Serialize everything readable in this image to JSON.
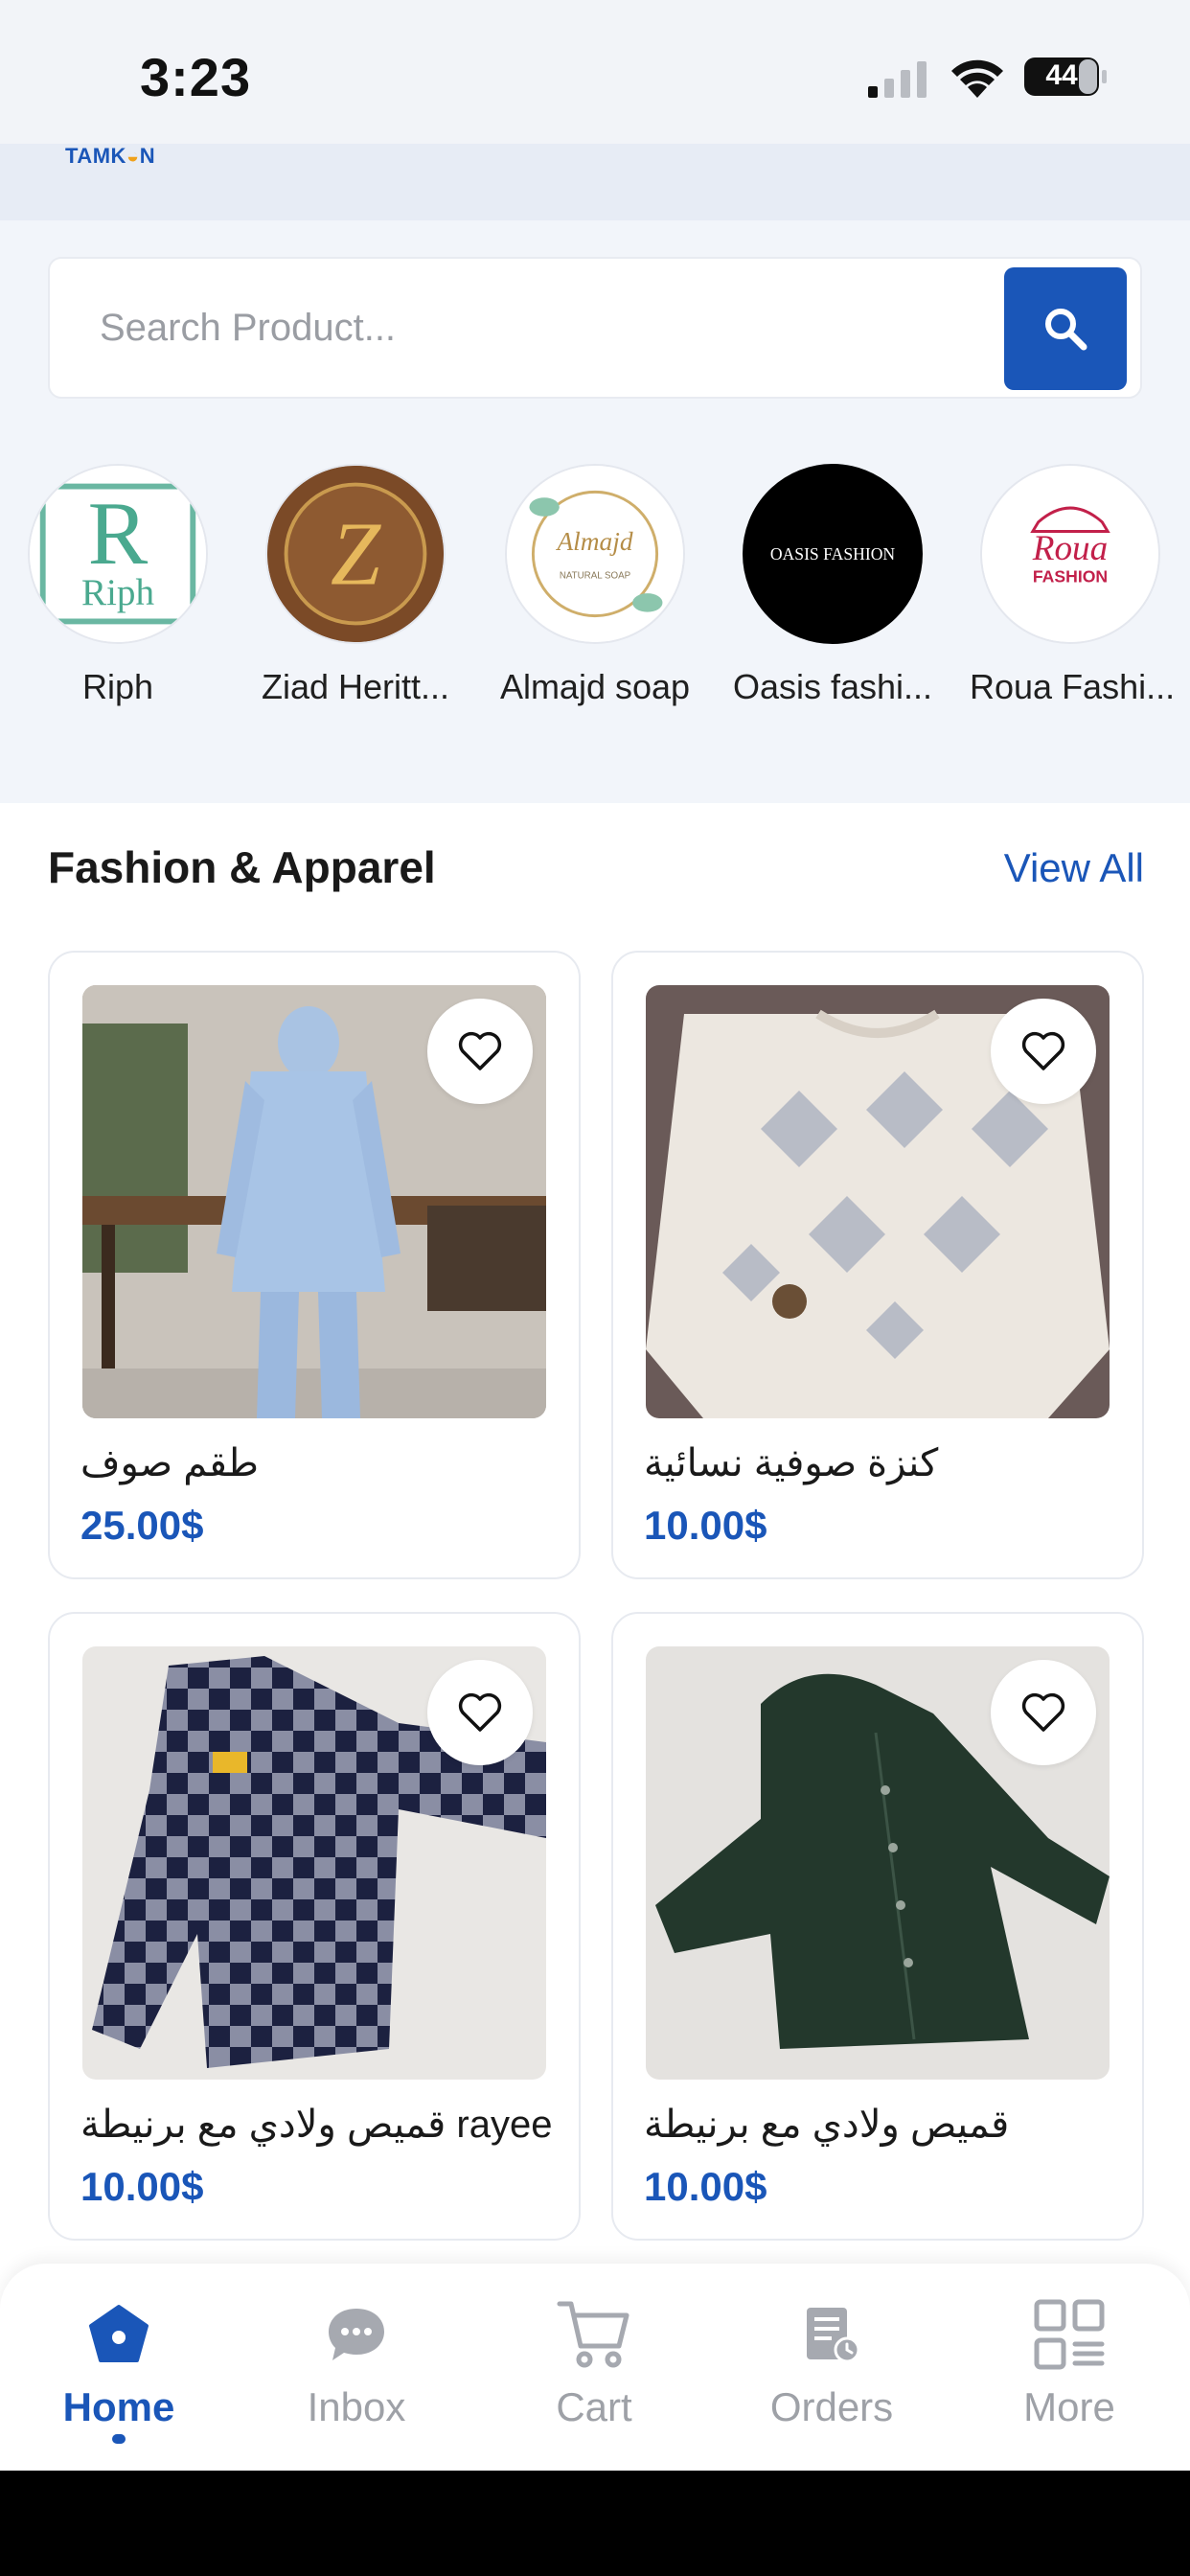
{
  "status_bar": {
    "time": "3:23",
    "battery": "44"
  },
  "brand": {
    "logo_text_a": "TAMK",
    "logo_text_b": "N"
  },
  "search": {
    "placeholder": "Search Product..."
  },
  "stores": [
    {
      "name": "Riph",
      "logo_text": "Riph"
    },
    {
      "name": "Ziad Heritt...",
      "logo_text": "Z"
    },
    {
      "name": "Almajd soap",
      "logo_text": "Almajd"
    },
    {
      "name": "Oasis fashi...",
      "logo_text": "OASIS FASHION"
    },
    {
      "name": "Roua Fashi...",
      "logo_text": "Roua"
    }
  ],
  "section": {
    "title": "Fashion & Apparel",
    "view_all": "View All"
  },
  "products": [
    {
      "name": "طقم صوف",
      "price": "25.00$"
    },
    {
      "name": "كنزة صوفية نسائية",
      "price": "10.00$"
    },
    {
      "name": "قميص ولادي مع برنيطة rayee",
      "price": "10.00$"
    },
    {
      "name": "قميص ولادي مع برنيطة",
      "price": "10.00$"
    }
  ],
  "nav": {
    "home": "Home",
    "inbox": "Inbox",
    "cart": "Cart",
    "orders": "Orders",
    "more": "More"
  },
  "colors": {
    "accent": "#1a56b8",
    "background": "#f2f5fa"
  }
}
